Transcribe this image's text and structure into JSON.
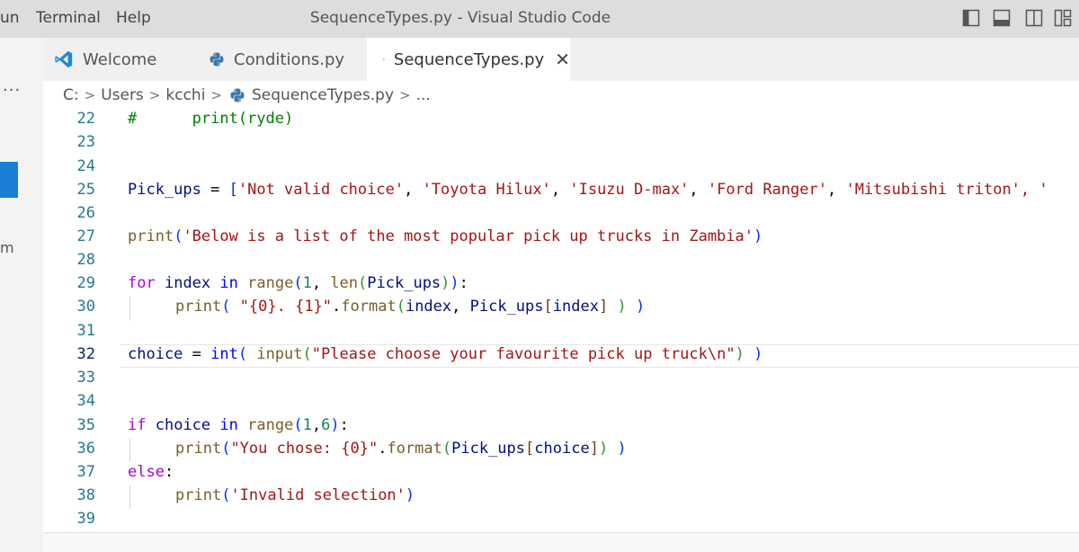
{
  "titlebar": {
    "menu": [
      "un",
      "Terminal",
      "Help"
    ],
    "title": "SequenceTypes.py - Visual Studio Code"
  },
  "sidebar": {
    "more": "···",
    "partial_label": "m"
  },
  "tabs": [
    {
      "label": "Welcome",
      "icon": "vscode-logo-icon",
      "active": false
    },
    {
      "label": "Conditions.py",
      "icon": "python-icon",
      "active": false
    },
    {
      "label": "SequenceTypes.py",
      "icon": "python-icon",
      "active": true,
      "close": "✕"
    }
  ],
  "breadcrumb": {
    "items": [
      "C:",
      "Users",
      "kcchi",
      "SequenceTypes.py",
      "..."
    ]
  },
  "editor": {
    "current_line": 32,
    "lines": [
      {
        "n": "22"
      },
      {
        "n": "23"
      },
      {
        "n": "24"
      },
      {
        "n": "25"
      },
      {
        "n": "26"
      },
      {
        "n": "27"
      },
      {
        "n": "28"
      },
      {
        "n": "29"
      },
      {
        "n": "30"
      },
      {
        "n": "31"
      },
      {
        "n": "32"
      },
      {
        "n": "33"
      },
      {
        "n": "34"
      },
      {
        "n": "35"
      },
      {
        "n": "36"
      },
      {
        "n": "37"
      },
      {
        "n": "38"
      },
      {
        "n": "39"
      }
    ],
    "tokens": {
      "l22": [
        "#      print(ryde)"
      ],
      "l25": [
        "Pick_ups",
        " = ",
        "[",
        "'Not valid choice'",
        ", ",
        "'Toyota Hilux'",
        ", ",
        "'Isuzu D-max'",
        ", ",
        "'Ford Ranger'",
        ", ",
        "'Mitsubishi triton'",
        ", '"
      ],
      "l27": [
        "print",
        "(",
        "'Below is a list of the most popular pick up trucks in Zambia'",
        ")"
      ],
      "l29": [
        "for",
        " ",
        "index",
        " ",
        "in",
        " ",
        "range",
        "(",
        "1",
        ", ",
        "len",
        "(",
        "Pick_ups",
        ")",
        ")",
        ":"
      ],
      "l30": [
        "print",
        "( ",
        "\"{0}. {1}\"",
        ".",
        "format",
        "(",
        "index",
        ", ",
        "Pick_ups",
        "[",
        "index",
        "]",
        " ",
        ")",
        " ",
        ")"
      ],
      "l32": [
        "choice",
        " = ",
        "int",
        "( ",
        "input",
        "(",
        "\"Please choose your favourite pick up truck\\n\"",
        ")",
        " ",
        ")"
      ],
      "l35": [
        "if",
        " ",
        "choice",
        " ",
        "in",
        " ",
        "range",
        "(",
        "1",
        ",",
        "6",
        ")",
        ":"
      ],
      "l36": [
        "print",
        "(",
        "\"You chose: {0}\"",
        ".",
        "format",
        "(",
        "Pick_ups",
        "[",
        "choice",
        "]",
        ")",
        " ",
        ")"
      ],
      "l37": [
        "else",
        ":"
      ],
      "l38": [
        "print",
        "(",
        "'Invalid selection'",
        ")"
      ]
    }
  },
  "colors": {
    "keyword_control": "#af00db",
    "keyword": "#0000ff",
    "function": "#795e26",
    "variable": "#001080",
    "string": "#a31515",
    "number": "#098658",
    "comment": "#008000",
    "line_number": "#237893",
    "accent": "#1a7fd4"
  }
}
